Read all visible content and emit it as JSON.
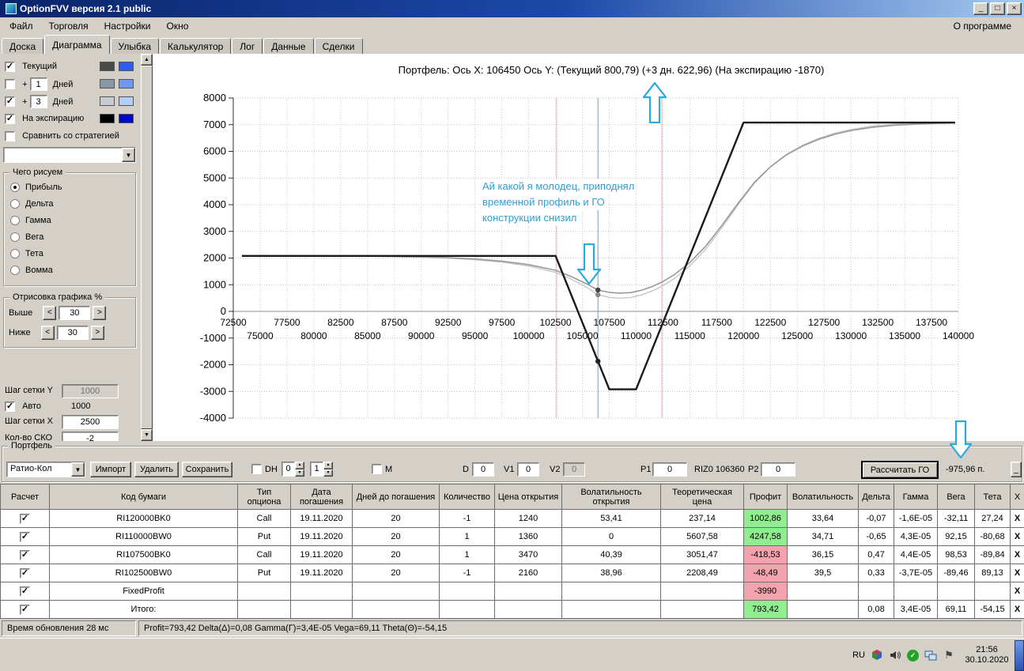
{
  "window": {
    "title": "OptionFVV версия 2.1 public"
  },
  "icons": {
    "check": "✓",
    "dropdown": "▼",
    "up": "▲",
    "down": "▼",
    "left": "<",
    "right": ">",
    "minimize": "_",
    "maximize": "□",
    "close": "×",
    "flag": "⚑"
  },
  "colors": {
    "profit_positive": "#90ee90",
    "profit_negative": "#f2a3ae",
    "annotation": "#2e9fd4",
    "arrow": "#29a9dd"
  },
  "menu": {
    "items": [
      "Файл",
      "Торговля",
      "Настройки",
      "Окно"
    ],
    "right": "О программе"
  },
  "tabs": {
    "items": [
      "Доска",
      "Диаграмма",
      "Улыбка",
      "Калькулятор",
      "Лог",
      "Данные",
      "Сделки"
    ],
    "active": "Диаграмма"
  },
  "left_panel": {
    "lines": [
      {
        "label": "Текущий",
        "checked": true,
        "colors": [
          "#4a4a4a",
          "#2e5cf0"
        ]
      },
      {
        "prefix": "+",
        "value": "1",
        "label": "Дней",
        "checked": false,
        "colors": [
          "#8a97a6",
          "#6f97f7"
        ]
      },
      {
        "prefix": "+",
        "value": "3",
        "label": "Дней",
        "checked": true,
        "colors": [
          "#c7ccd3",
          "#b2cdf8"
        ]
      },
      {
        "label": "На экспирацию",
        "checked": true,
        "colors": [
          "#000000",
          "#0008c8"
        ]
      },
      {
        "label": "Сравнить со стратегией",
        "checked": false
      }
    ],
    "draw_group": {
      "title": "Чего рисуем",
      "options": [
        "Прибыль",
        "Дельта",
        "Гамма",
        "Вега",
        "Тета",
        "Вомма"
      ],
      "selected": "Прибыль"
    },
    "render_group": {
      "title": "Отрисовка графика %",
      "rows": [
        {
          "label": "Выше",
          "value": "30"
        },
        {
          "label": "Ниже",
          "value": "30"
        }
      ]
    },
    "grid_y_label": "Шаг сетки Y",
    "grid_y_value": "1000",
    "auto_label": "Авто",
    "auto_value": "1000",
    "grid_x_label": "Шаг сетки X",
    "grid_x_value": "2500",
    "sko_label": "Кол-во СКО",
    "sko_value": "-2"
  },
  "annotation": {
    "lines": [
      "Ай какой я молодец, приподнял",
      "временной профиль и ГО",
      "конструкции снизил"
    ]
  },
  "chart_data": {
    "type": "line",
    "title": "Портфель: Ось X: 106450 Ось Y:  (Текущий 800,79)  (+3 дн. 622,96)  (На экспирацию -1870)",
    "xlim": [
      72500,
      140000
    ],
    "ylim": [
      -4000,
      8000
    ],
    "x_tick_step": 2500,
    "y_tick_step": 1000,
    "grid": true,
    "vlines": [
      {
        "x": 102600,
        "color": "#f0a7b5"
      },
      {
        "x": 112400,
        "color": "#f0a7b5"
      },
      {
        "x": 106450,
        "color": "#7e9ab8"
      }
    ],
    "series": [
      {
        "name": "На экспирацию",
        "color": "#1a1a1a",
        "width": 2.4,
        "points": [
          [
            73300,
            2080
          ],
          [
            102500,
            2080
          ],
          [
            107500,
            -2920
          ],
          [
            110000,
            -2920
          ],
          [
            120000,
            7080
          ],
          [
            139700,
            7080
          ]
        ]
      },
      {
        "name": "Текущий",
        "color": "#9a9a9a",
        "width": 1.6,
        "points": [
          [
            73300,
            2090
          ],
          [
            80000,
            2085
          ],
          [
            85000,
            2075
          ],
          [
            88000,
            2060
          ],
          [
            90000,
            2045
          ],
          [
            92500,
            2015
          ],
          [
            95000,
            1965
          ],
          [
            97500,
            1885
          ],
          [
            100000,
            1755
          ],
          [
            102500,
            1540
          ],
          [
            104000,
            1300
          ],
          [
            105500,
            1010
          ],
          [
            106450,
            801
          ],
          [
            107500,
            715
          ],
          [
            108500,
            685
          ],
          [
            109500,
            705
          ],
          [
            110500,
            790
          ],
          [
            111500,
            930
          ],
          [
            112500,
            1120
          ],
          [
            113500,
            1360
          ],
          [
            115000,
            1830
          ],
          [
            116500,
            2450
          ],
          [
            118000,
            3230
          ],
          [
            119500,
            4060
          ],
          [
            121000,
            4830
          ],
          [
            122500,
            5420
          ],
          [
            124000,
            5870
          ],
          [
            125500,
            6200
          ],
          [
            127000,
            6450
          ],
          [
            128500,
            6640
          ],
          [
            130000,
            6780
          ],
          [
            132000,
            6900
          ],
          [
            134000,
            6975
          ],
          [
            136000,
            7020
          ],
          [
            138000,
            7050
          ],
          [
            139700,
            7065
          ]
        ]
      },
      {
        "name": "+3 дней",
        "color": "#c6c6c6",
        "width": 1.4,
        "points": [
          [
            73300,
            2088
          ],
          [
            85000,
            2068
          ],
          [
            90000,
            2030
          ],
          [
            92500,
            1995
          ],
          [
            95000,
            1935
          ],
          [
            97500,
            1845
          ],
          [
            100000,
            1700
          ],
          [
            102500,
            1465
          ],
          [
            104000,
            1200
          ],
          [
            105500,
            880
          ],
          [
            106450,
            623
          ],
          [
            107500,
            525
          ],
          [
            108500,
            495
          ],
          [
            109500,
            520
          ],
          [
            110500,
            615
          ],
          [
            111500,
            765
          ],
          [
            112500,
            965
          ],
          [
            113500,
            1215
          ],
          [
            115000,
            1705
          ],
          [
            116500,
            2340
          ],
          [
            118000,
            3140
          ],
          [
            119500,
            4000
          ],
          [
            121000,
            4800
          ],
          [
            122500,
            5420
          ],
          [
            124000,
            5890
          ],
          [
            125500,
            6230
          ],
          [
            127000,
            6490
          ],
          [
            128500,
            6685
          ],
          [
            130000,
            6820
          ],
          [
            132000,
            6945
          ],
          [
            134000,
            7015
          ],
          [
            136000,
            7055
          ],
          [
            138000,
            7075
          ],
          [
            139700,
            7080
          ]
        ]
      }
    ],
    "markers": [
      {
        "x": 106450,
        "y": 801,
        "color": "#444444"
      },
      {
        "x": 106450,
        "y": 623,
        "color": "#8a8a8a"
      },
      {
        "x": 106450,
        "y": -1870,
        "color": "#222222"
      }
    ]
  },
  "portfolio": {
    "group_label": "Портфель",
    "strategy_value": "Ратио-Кол",
    "import_label": "Импорт",
    "delete_label": "Удалить",
    "save_label": "Сохранить",
    "dh_label": "DH",
    "dh_value1": "0",
    "dh_value2": "1",
    "m_label": "M",
    "d_label": "D",
    "d_value": "0",
    "v1_label": "V1",
    "v1_value": "0",
    "v2_label": "V2",
    "v2_value": "0",
    "p1_label": "P1",
    "p1_value": "0",
    "riz_label": "RIZ0 106360",
    "p2_label": "P2",
    "p2_value": "0",
    "calc_go_label": "Рассчитать ГО",
    "go_value": "-975,96 п.",
    "mini_button_label": "_"
  },
  "table": {
    "headers": [
      "Расчет",
      "Код бумаги",
      "Тип опциона",
      "Дата погашения",
      "Дней до погашения",
      "Количество",
      "Цена открытия",
      "Волатильность открытия",
      "Теоретическая цена",
      "Профит",
      "Волатильность",
      "Дельта",
      "Гамма",
      "Вега",
      "Тета",
      "X"
    ],
    "row_close_label": "X",
    "rows": [
      {
        "checked": true,
        "code": "RI120000BK0",
        "type": "Call",
        "expiry": "19.11.2020",
        "days": "20",
        "qty": "-1",
        "open_price": "1240",
        "open_vol": "53,41",
        "theo_price": "237,14",
        "profit": "1002,86",
        "vol": "33,64",
        "delta": "-0,07",
        "gamma": "-1,6E-05",
        "vega": "-32,11",
        "theta": "27,24"
      },
      {
        "checked": true,
        "code": "RI110000BW0",
        "type": "Put",
        "expiry": "19.11.2020",
        "days": "20",
        "qty": "1",
        "open_price": "1360",
        "open_vol": "0",
        "theo_price": "5607,58",
        "profit": "4247,58",
        "vol": "34,71",
        "delta": "-0,65",
        "gamma": "4,3E-05",
        "vega": "92,15",
        "theta": "-80,68"
      },
      {
        "checked": true,
        "code": "RI107500BK0",
        "type": "Call",
        "expiry": "19.11.2020",
        "days": "20",
        "qty": "1",
        "open_price": "3470",
        "open_vol": "40,39",
        "theo_price": "3051,47",
        "profit": "-418,53",
        "vol": "36,15",
        "delta": "0,47",
        "gamma": "4,4E-05",
        "vega": "98,53",
        "theta": "-89,84"
      },
      {
        "checked": true,
        "code": "RI102500BW0",
        "type": "Put",
        "expiry": "19.11.2020",
        "days": "20",
        "qty": "-1",
        "open_price": "2160",
        "open_vol": "38,96",
        "theo_price": "2208,49",
        "profit": "-48,49",
        "vol": "39,5",
        "delta": "0,33",
        "gamma": "-3,7E-05",
        "vega": "-89,46",
        "theta": "89,13"
      },
      {
        "checked": true,
        "code": "FixedProfit",
        "type": "",
        "expiry": "",
        "days": "",
        "qty": "",
        "open_price": "",
        "open_vol": "",
        "theo_price": "",
        "profit": "-3990",
        "vol": "",
        "delta": "",
        "gamma": "",
        "vega": "",
        "theta": ""
      },
      {
        "checked": true,
        "code": "Итого:",
        "type": "",
        "expiry": "",
        "days": "",
        "qty": "",
        "open_price": "",
        "open_vol": "",
        "theo_price": "",
        "profit": "793,42",
        "vol": "",
        "delta": "0,08",
        "gamma": "3,4E-05",
        "vega": "69,11",
        "theta": "-54,15"
      }
    ]
  },
  "statusbar": {
    "update_time": "Время обновления 28 мс",
    "greeks": "Profit=793,42 Delta(Δ)=0,08 Gamma(Г)=3,4E-05 Vega=69,11 Theta(Θ)=-54,15"
  },
  "taskbar": {
    "language": "RU",
    "time": "21:56",
    "date": "30.10.2020"
  }
}
